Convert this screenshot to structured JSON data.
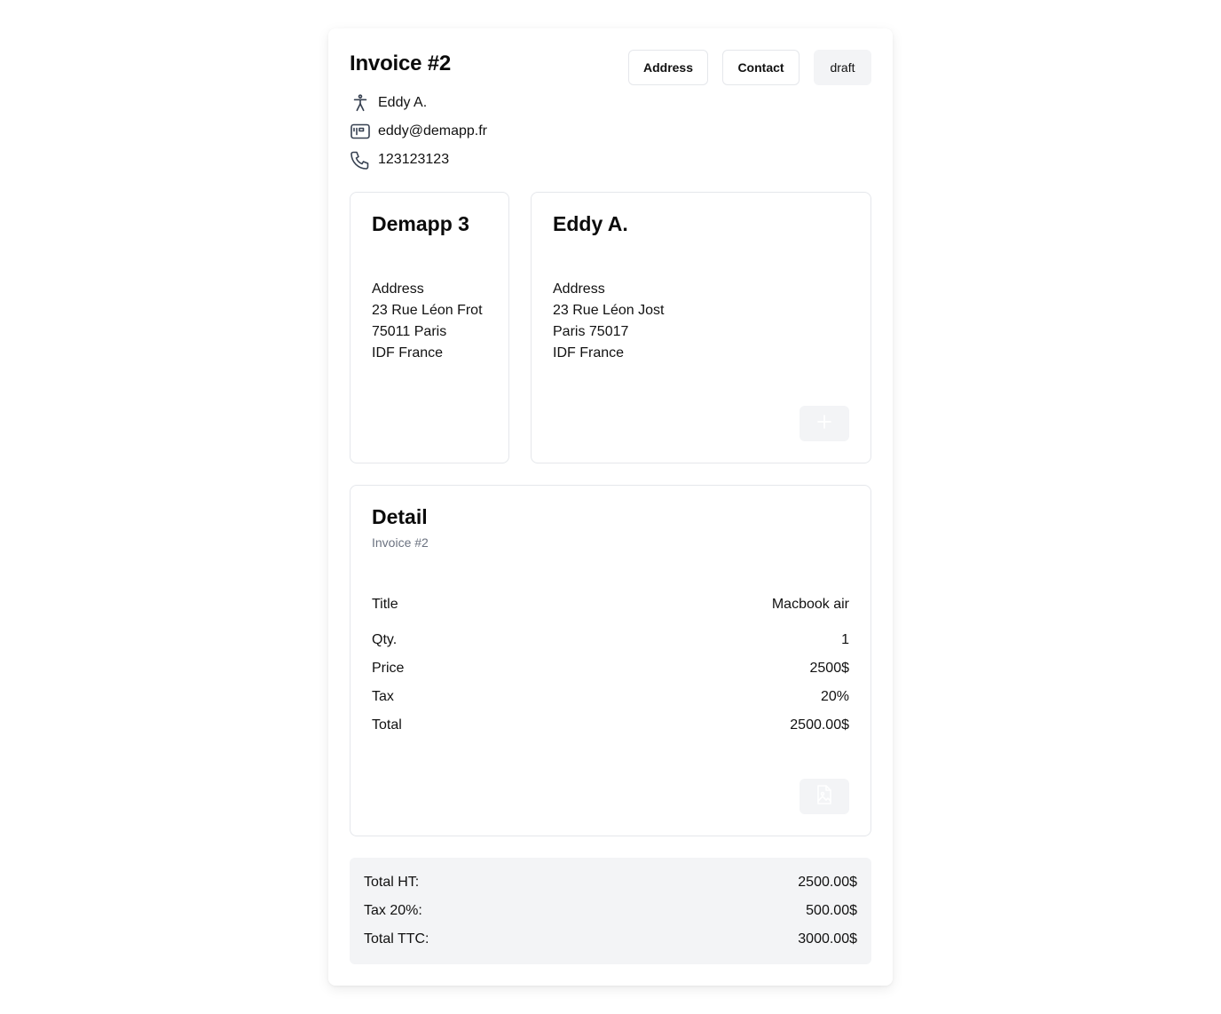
{
  "invoice": {
    "title": "Invoice #2",
    "buttons": {
      "address": "Address",
      "contact": "Contact",
      "status": "draft"
    }
  },
  "contact": {
    "name": "Eddy A.",
    "email": "eddy@demapp.fr",
    "phone": "123123123"
  },
  "sender": {
    "name": "Demapp 3",
    "address_label": "Address",
    "lines": [
      "23 Rue Léon Frot",
      "75011 Paris",
      "IDF France"
    ]
  },
  "recipient": {
    "name": "Eddy A.",
    "address_label": "Address",
    "lines": [
      "23 Rue Léon Jost",
      "Paris 75017",
      "IDF France"
    ]
  },
  "detail": {
    "heading": "Detail",
    "subheading": "Invoice #2",
    "rows": [
      {
        "label": "Title",
        "value": "Macbook air"
      },
      {
        "label": "Qty.",
        "value": "1"
      },
      {
        "label": "Price",
        "value": "2500$"
      },
      {
        "label": "Tax",
        "value": "20%"
      },
      {
        "label": "Total",
        "value": "2500.00$"
      }
    ]
  },
  "totals": [
    {
      "label": "Total HT:",
      "value": "2500.00$"
    },
    {
      "label": "Tax 20%:",
      "value": "500.00$"
    },
    {
      "label": "Total TTC:",
      "value": "3000.00$"
    }
  ],
  "icons": {
    "person": "accessibility-icon",
    "email": "id-card-icon",
    "phone": "phone-icon",
    "add": "plus-icon",
    "pdf": "file-image-icon"
  },
  "colors": {
    "muted": "#6b7280",
    "border": "#e5e7eb",
    "bg_soft": "#f3f4f6"
  }
}
